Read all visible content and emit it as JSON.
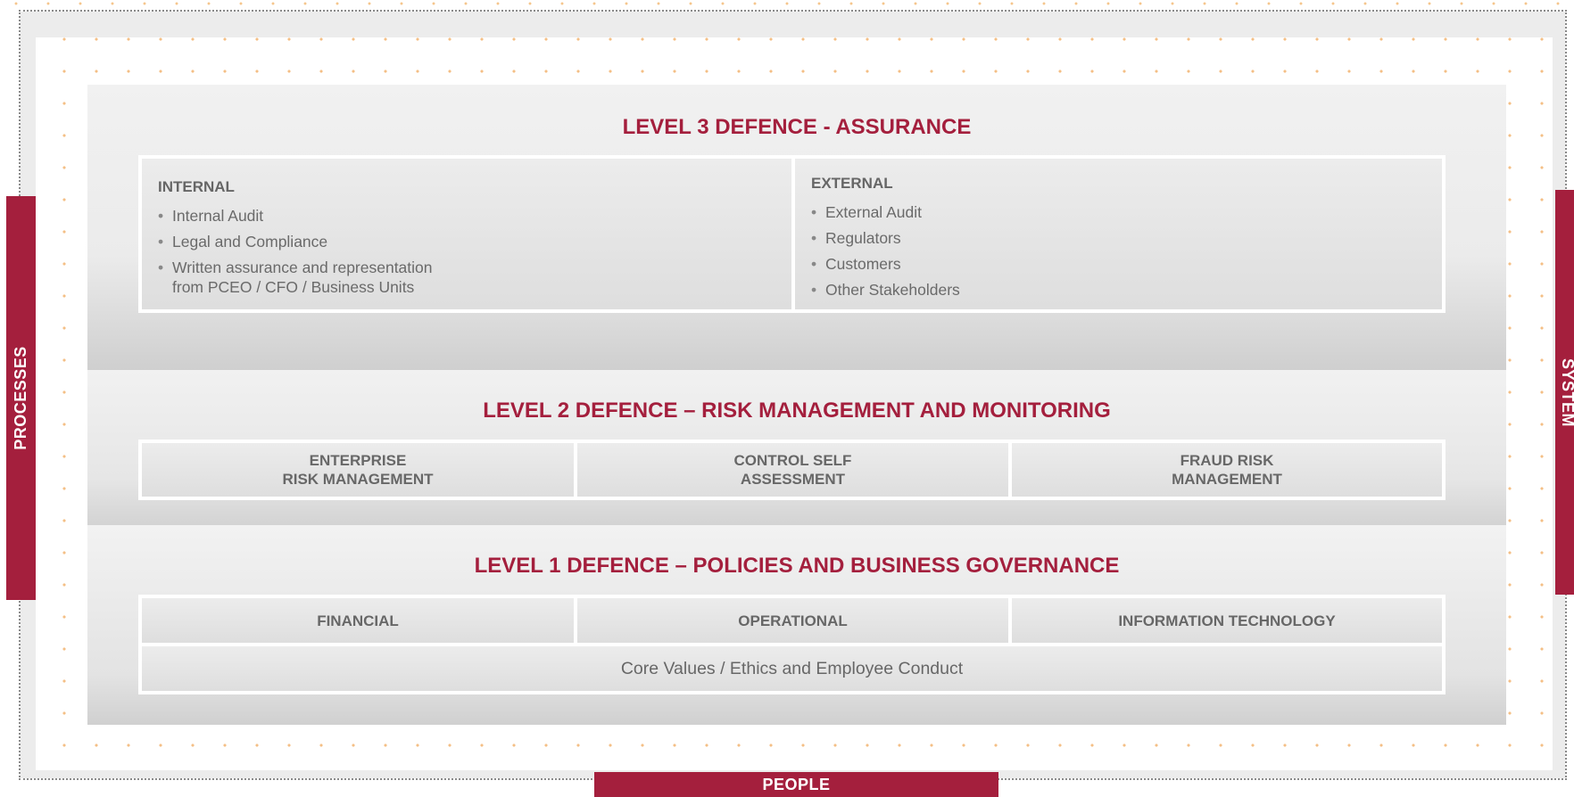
{
  "colors": {
    "accent": "#a41f3d",
    "text": "#676767",
    "dots": "#f4bf86"
  },
  "tabs": {
    "left": "PROCESSES",
    "right": "SYSTEM",
    "bottom": "PEOPLE"
  },
  "level3": {
    "title": "LEVEL 3 DEFENCE - ASSURANCE",
    "internal": {
      "heading": "INTERNAL",
      "items": [
        "Internal Audit",
        "Legal and Compliance",
        "Written assurance and representation\nfrom PCEO / CFO / Business Units"
      ]
    },
    "external": {
      "heading": "EXTERNAL",
      "items": [
        "External Audit",
        "Regulators",
        "Customers",
        "Other Stakeholders"
      ]
    }
  },
  "level2": {
    "title": "LEVEL 2 DEFENCE – RISK MANAGEMENT AND MONITORING",
    "cells": [
      "ENTERPRISE\nRISK MANAGEMENT",
      "CONTROL SELF\nASSESSMENT",
      "FRAUD RISK\nMANAGEMENT"
    ]
  },
  "level1": {
    "title": "LEVEL 1 DEFENCE – POLICIES AND BUSINESS GOVERNANCE",
    "cells": [
      "FINANCIAL",
      "OPERATIONAL",
      "INFORMATION TECHNOLOGY"
    ],
    "footer": "Core Values / Ethics and Employee Conduct"
  }
}
